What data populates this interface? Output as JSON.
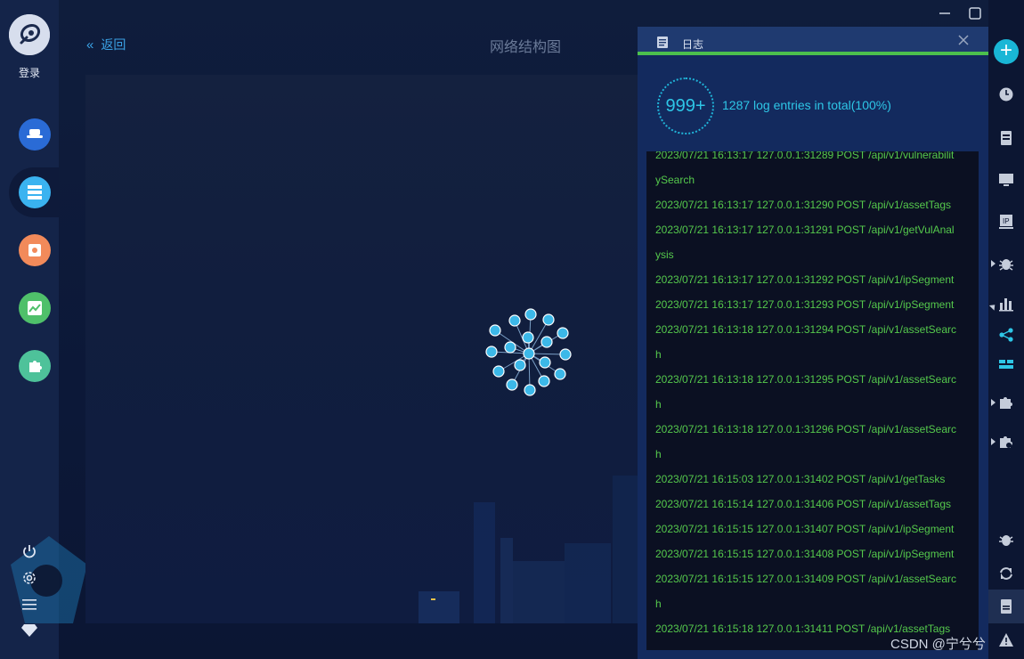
{
  "sidebar": {
    "login_label": "登录",
    "nav": [
      {
        "icon": "hat-icon",
        "color": "#2a6bd6"
      },
      {
        "icon": "server-icon",
        "color": "#3ab3f0"
      },
      {
        "icon": "bug-doc-icon",
        "color": "#f28a5a"
      },
      {
        "icon": "chart-icon",
        "color": "#4fc06a"
      },
      {
        "icon": "puzzle-icon",
        "color": "#4ec29a"
      }
    ],
    "bottom": [
      "power-icon",
      "gear-icon",
      "menu-icon",
      "gem-icon"
    ]
  },
  "header": {
    "back_label": "返回",
    "title": "网络结构图"
  },
  "log_panel": {
    "title": "日志",
    "count_badge": "999+",
    "summary": "1287 log entries in total(100%)",
    "lines": [
      "2023/07/21 16:13:17 127.0.0.1:31289 POST /api/v1/vulnerabilit",
      "ySearch",
      "2023/07/21 16:13:17 127.0.0.1:31290 POST /api/v1/assetTags",
      "2023/07/21 16:13:17 127.0.0.1:31291 POST /api/v1/getVulAnal",
      "ysis",
      "2023/07/21 16:13:17 127.0.0.1:31292 POST /api/v1/ipSegment",
      "2023/07/21 16:13:17 127.0.0.1:31293 POST /api/v1/ipSegment",
      "2023/07/21 16:13:18 127.0.0.1:31294 POST /api/v1/assetSearc",
      "h",
      "2023/07/21 16:13:18 127.0.0.1:31295 POST /api/v1/assetSearc",
      "h",
      "2023/07/21 16:13:18 127.0.0.1:31296 POST /api/v1/assetSearc",
      "h",
      "2023/07/21 16:15:03 127.0.0.1:31402 POST /api/v1/getTasks",
      "2023/07/21 16:15:14 127.0.0.1:31406 POST /api/v1/assetTags",
      "2023/07/21 16:15:15 127.0.0.1:31407 POST /api/v1/ipSegment",
      "2023/07/21 16:15:15 127.0.0.1:31408 POST /api/v1/ipSegment",
      "2023/07/21 16:15:15 127.0.0.1:31409 POST /api/v1/assetSearc",
      "h",
      "2023/07/21 16:15:18 127.0.0.1:31411 POST /api/v1/assetTags"
    ]
  },
  "colors": {
    "accent": "#19b6d6",
    "log_text": "#55c94c",
    "node": "#3cb8e8",
    "progress": "#4cc04d"
  },
  "watermark": "CSDN @宁兮兮"
}
